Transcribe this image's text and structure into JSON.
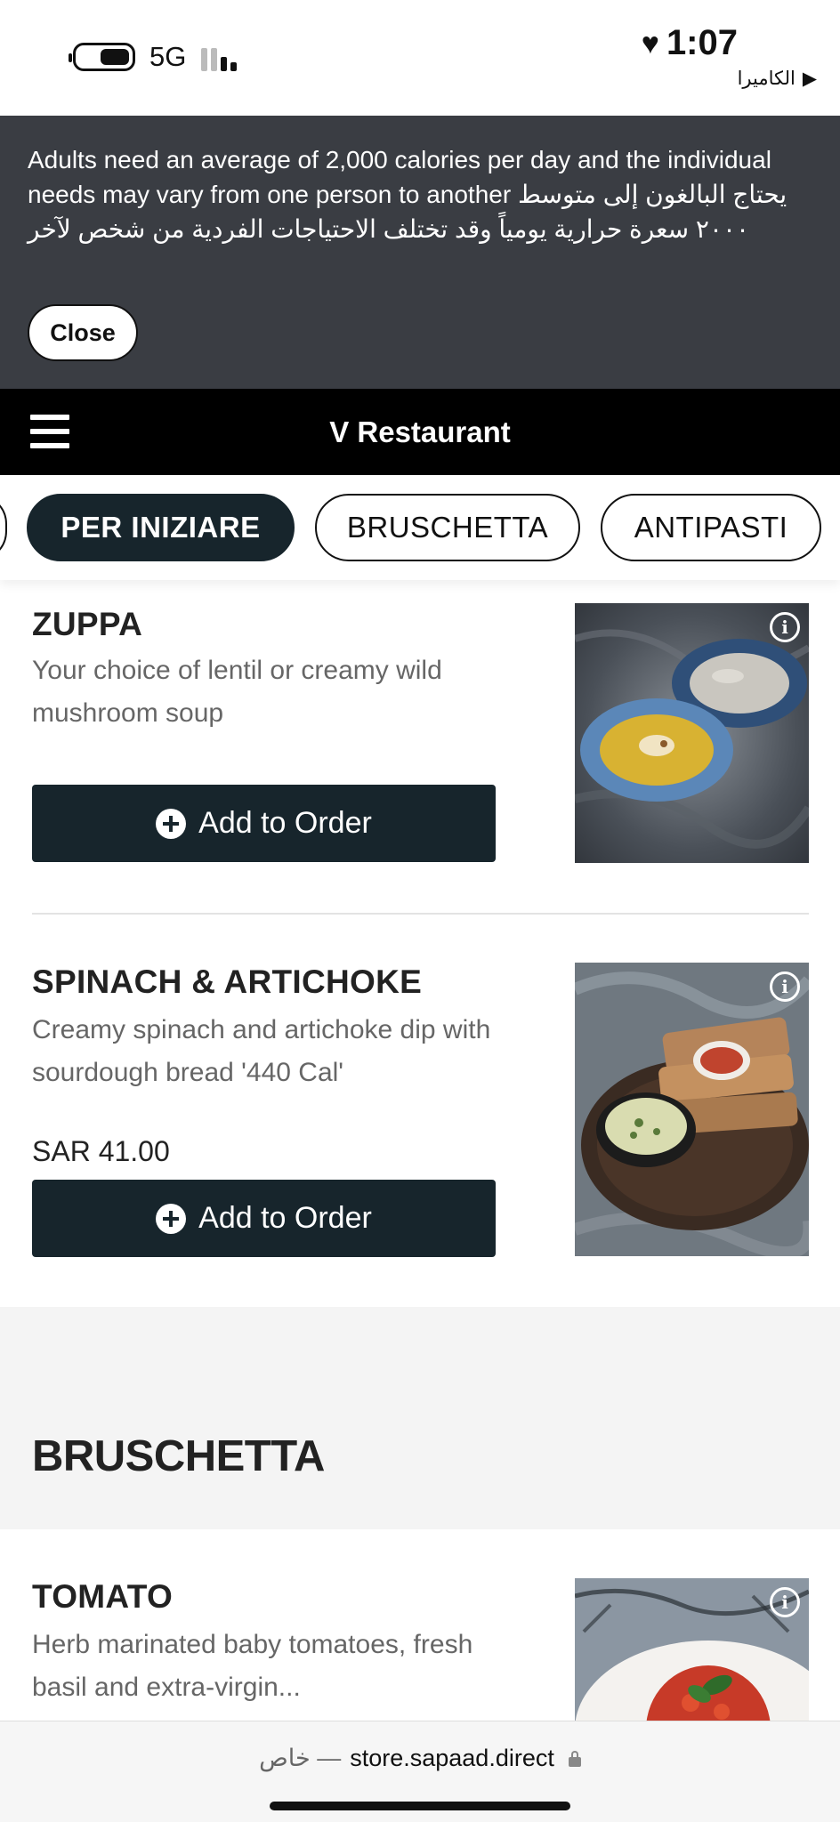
{
  "status_bar": {
    "network": "5G",
    "time": "1:07",
    "back_app": "الكاميرا",
    "back_arrow": "▶"
  },
  "notice": {
    "text": "Adults need an average of 2,000 calories per day and the individual needs may vary from one person to another يحتاج البالغون إلى متوسط ٢٠٠٠ سعرة حرارية يومياً وقد تختلف الاحتياجات الفردية من شخص لآخر",
    "close_label": "Close"
  },
  "header": {
    "title": "V Restaurant"
  },
  "tabs": [
    {
      "label": "PER INIZIARE",
      "active": true
    },
    {
      "label": "BRUSCHETTA",
      "active": false
    },
    {
      "label": "ANTIPASTI",
      "active": false
    }
  ],
  "items": [
    {
      "title": "ZUPPA",
      "description": "Your choice of lentil or creamy wild mushroom soup",
      "price": "",
      "add_label": "Add to Order"
    },
    {
      "title": "SPINACH & ARTICHOKE",
      "description": "Creamy spinach and artichoke dip with sourdough bread '440 Cal'",
      "price": "SAR 41.00",
      "add_label": "Add to Order"
    },
    {
      "title": "TOMATO",
      "description": "Herb marinated baby tomatoes, fresh basil and extra-virgin..."
    }
  ],
  "sections": {
    "bruschetta_title": "BRUSCHETTA"
  },
  "browser": {
    "private_label": "خاص —",
    "url": "store.sapaad.direct"
  },
  "icons": {
    "info": "info-icon",
    "plus": "plus-circle-icon",
    "menu": "hamburger-icon",
    "lock": "lock-icon"
  },
  "colors": {
    "notice_bg": "#3a3d43",
    "header_bg": "#000000",
    "accent_dark": "#17252c",
    "section_bg": "#f4f4f4"
  }
}
